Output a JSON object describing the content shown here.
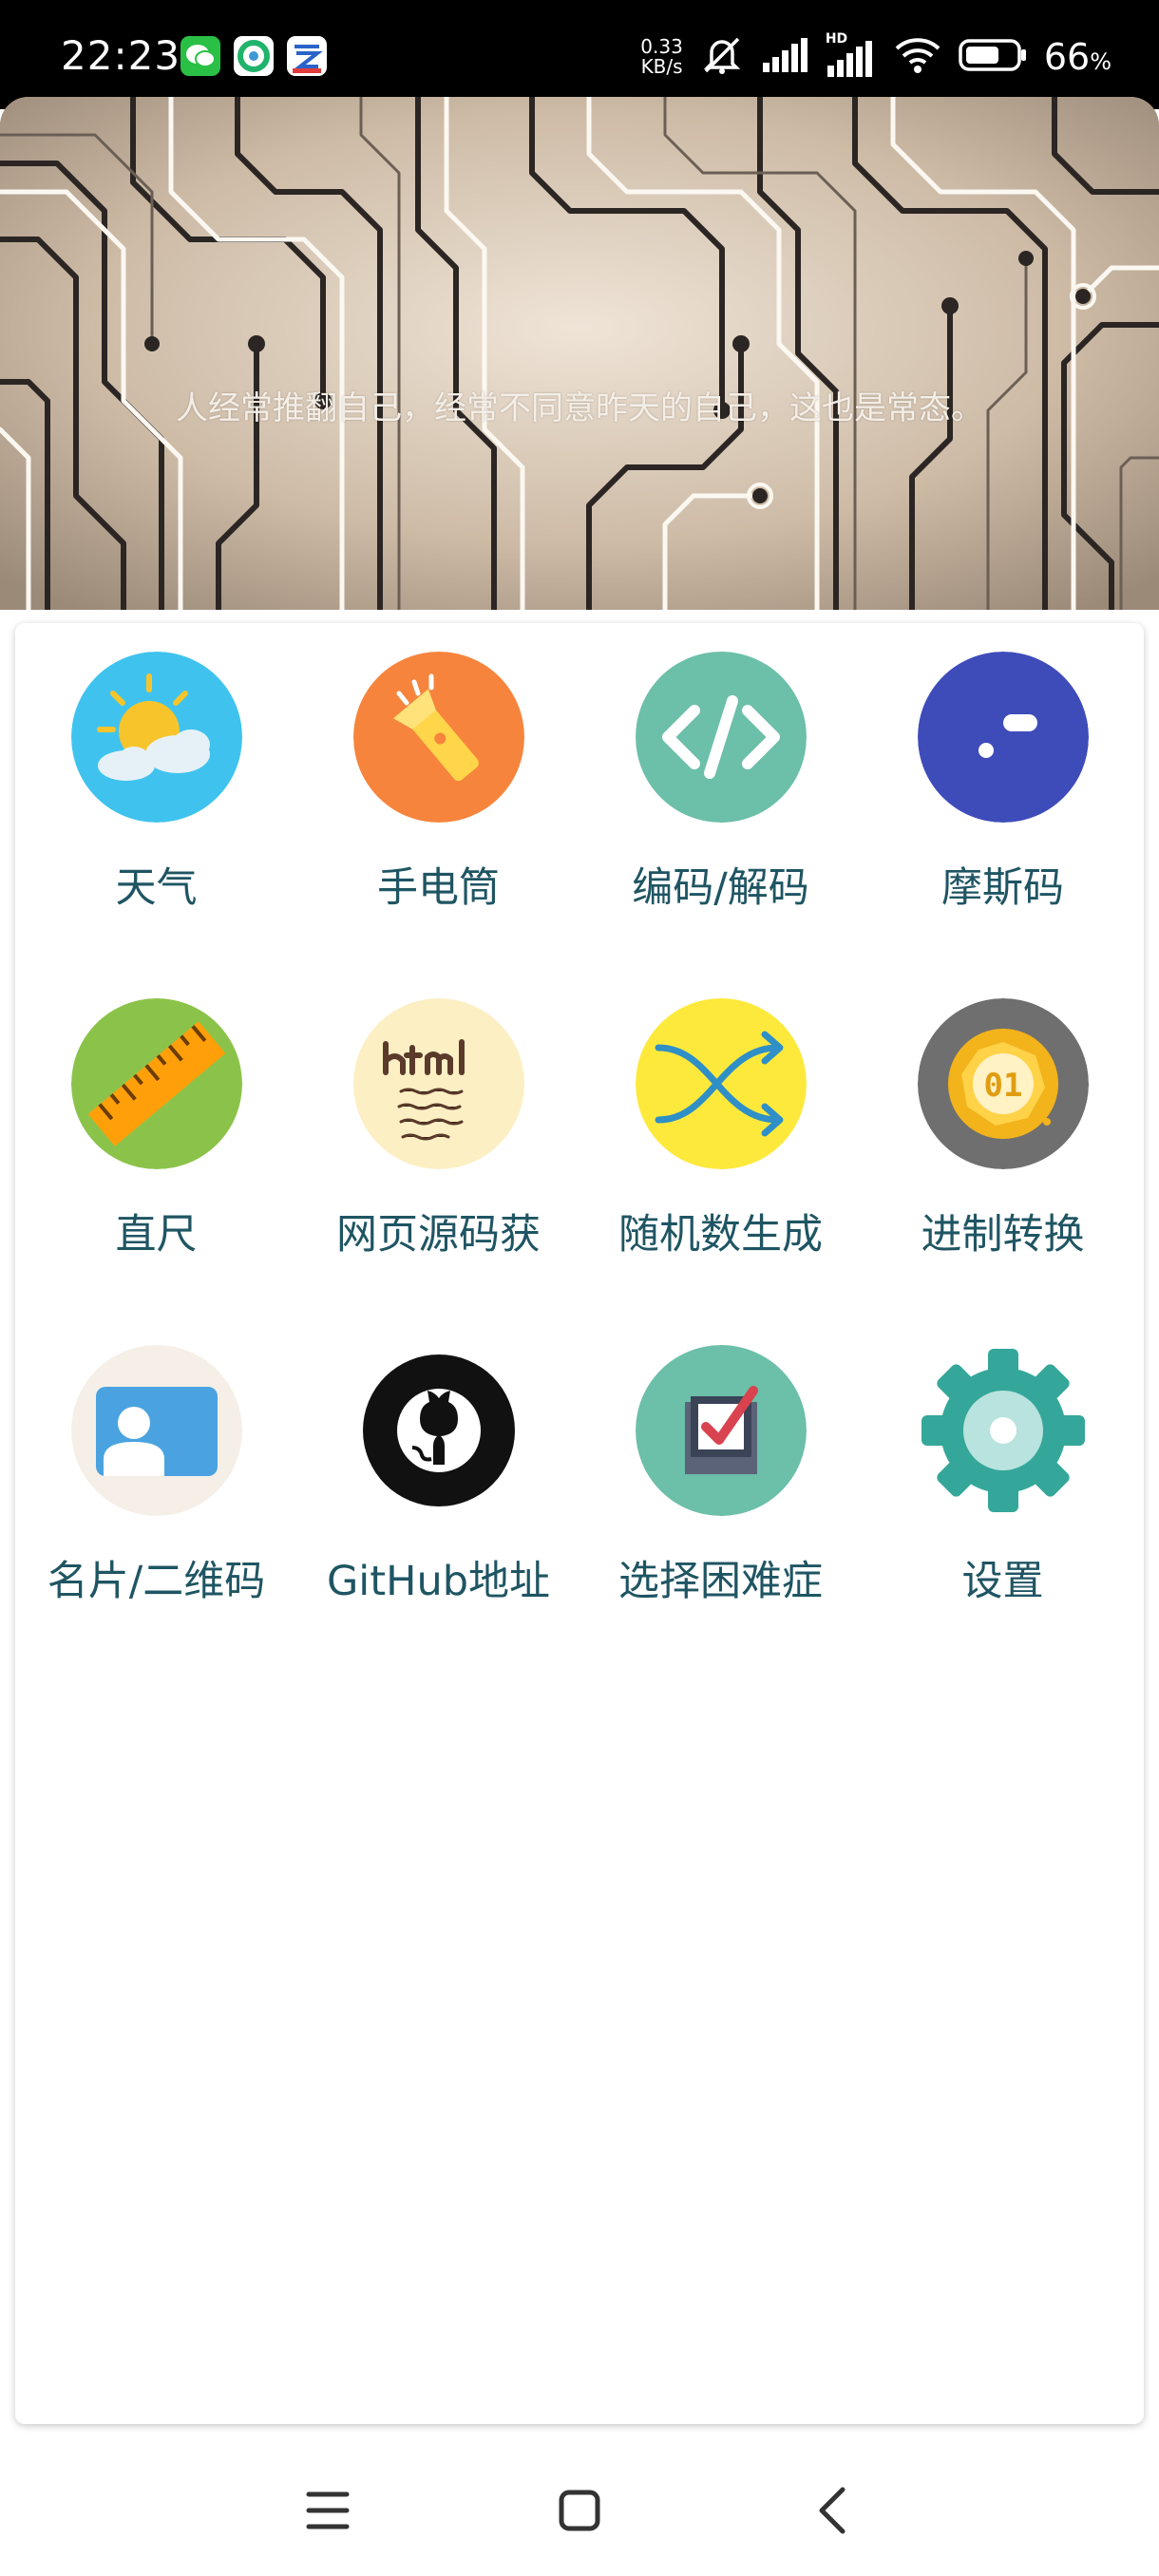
{
  "status_bar": {
    "time": "22:23",
    "net_speed_value": "0.33",
    "net_speed_unit": "KB/s",
    "hd_label": "HD",
    "battery_percent": "66",
    "battery_unit": "%",
    "battery_level": 0.66,
    "notification_icons": [
      "wechat-icon",
      "green-app-icon",
      "cloud-app-icon"
    ]
  },
  "banner": {
    "quote": "人经常推翻自己，经常不同意昨天的自己，这也是常态。"
  },
  "tools": [
    {
      "label": "天气",
      "icon": "weather-icon"
    },
    {
      "label": "手电筒",
      "icon": "flashlight-icon"
    },
    {
      "label": "编码/解码",
      "icon": "code-icon"
    },
    {
      "label": "摩斯码",
      "icon": "morse-icon"
    },
    {
      "label": "直尺",
      "icon": "ruler-icon"
    },
    {
      "label": "网页源码获",
      "icon": "html-icon"
    },
    {
      "label": "随机数生成",
      "icon": "shuffle-icon"
    },
    {
      "label": "进制转换",
      "icon": "binary-coin-icon"
    },
    {
      "label": "名片/二维码",
      "icon": "business-card-icon"
    },
    {
      "label": "GitHub地址",
      "icon": "github-icon"
    },
    {
      "label": "选择困难症",
      "icon": "checkbox-icon"
    },
    {
      "label": "设置",
      "icon": "gear-icon"
    }
  ],
  "colors": {
    "label": "#1f5563",
    "weather_bg": "#3fc3ee",
    "flashlight_bg": "#f7843c",
    "code_bg": "#6cbfa9",
    "morse_bg": "#3e4cba",
    "ruler_bg": "#8bc34a",
    "html_bg": "#fdefc4",
    "shuffle_bg": "#fde93c",
    "binary_bg": "#6f6f6f",
    "card_bg": "#f5efe7",
    "github_bg": "#111111",
    "checkbox_bg": "#6cbfa9",
    "gear": "#34a79a"
  },
  "nav_bar": {
    "buttons": [
      "menu-icon",
      "home-icon",
      "back-icon"
    ]
  }
}
